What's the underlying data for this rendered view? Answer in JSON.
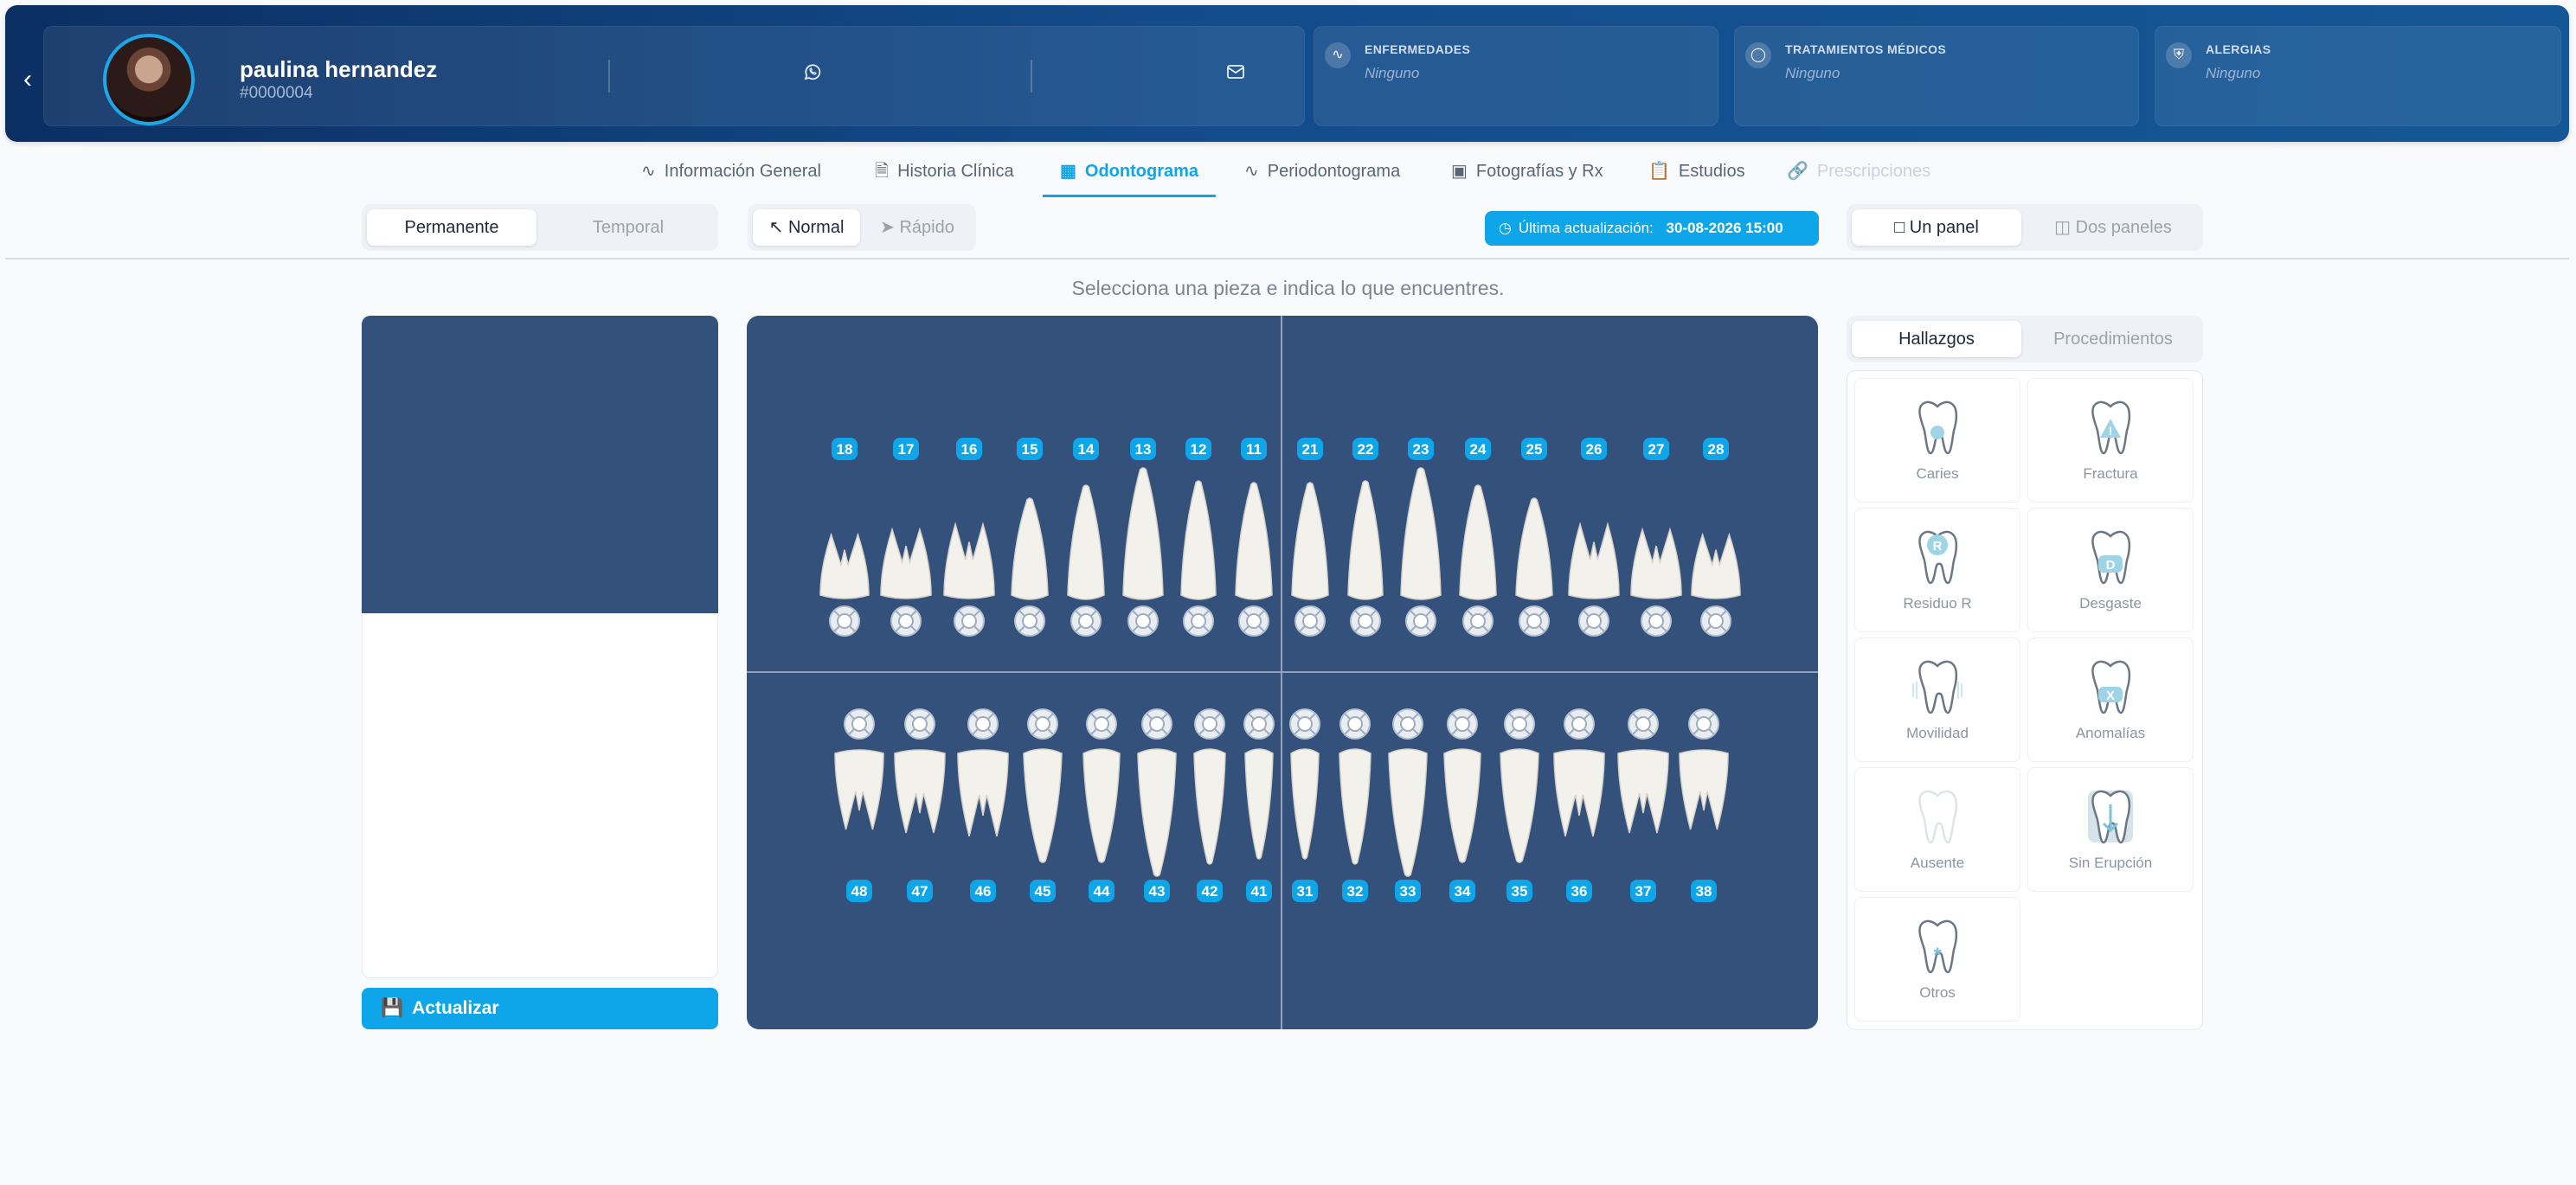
{
  "patient": {
    "name": "paulina hernandez",
    "id": "#0000004"
  },
  "header_icons": [
    "whatsapp-icon",
    "mail-icon"
  ],
  "info_cards": [
    {
      "title": "ENFERMEDADES",
      "value": "Ninguno",
      "icon": "heartbeat-icon"
    },
    {
      "title": "TRATAMIENTOS MÉDICOS",
      "value": "Ninguno",
      "icon": "pill-icon"
    },
    {
      "title": "ALERGIAS",
      "value": "Ninguno",
      "icon": "shield-icon"
    }
  ],
  "tabs": [
    {
      "label": "Información General",
      "icon": "activity-icon",
      "state": "normal"
    },
    {
      "label": "Historia Clínica",
      "icon": "document-icon",
      "state": "normal"
    },
    {
      "label": "Odontograma",
      "icon": "grid-icon",
      "state": "active"
    },
    {
      "label": "Periodontograma",
      "icon": "activity-icon",
      "state": "normal"
    },
    {
      "label": "Fotografías y Rx",
      "icon": "camera-icon",
      "state": "normal"
    },
    {
      "label": "Estudios",
      "icon": "clipboard-icon",
      "state": "normal"
    },
    {
      "label": "Prescripciones",
      "icon": "link-icon",
      "state": "disabled"
    }
  ],
  "toolbar": {
    "dentition": {
      "options": [
        "Permanente",
        "Temporal"
      ],
      "selected": "Permanente"
    },
    "mode": {
      "options": [
        "Normal",
        "Rápido"
      ],
      "selected": "Normal"
    },
    "last_update_label": "Última actualización:",
    "last_update_value": "30-08-2026 15:00",
    "panels": {
      "options": [
        "Un panel",
        "Dos paneles"
      ],
      "selected": "Un panel"
    }
  },
  "hint": "Selecciona una pieza e indica lo que encuentres.",
  "update_button": "Actualizar",
  "odontogram": {
    "upper_teeth": [
      "18",
      "17",
      "16",
      "15",
      "14",
      "13",
      "12",
      "11",
      "21",
      "22",
      "23",
      "24",
      "25",
      "26",
      "27",
      "28"
    ],
    "lower_teeth": [
      "48",
      "47",
      "46",
      "45",
      "44",
      "43",
      "42",
      "41",
      "31",
      "32",
      "33",
      "34",
      "35",
      "36",
      "37",
      "38"
    ]
  },
  "right_panel": {
    "tabs": [
      "Hallazgos",
      "Procedimientos"
    ],
    "selected": "Hallazgos",
    "findings": [
      {
        "label": "Caries",
        "icon": "caries-icon"
      },
      {
        "label": "Fractura",
        "icon": "fracture-icon"
      },
      {
        "label": "Residuo R",
        "icon": "residue-icon",
        "badge": "R"
      },
      {
        "label": "Desgaste",
        "icon": "wear-icon",
        "badge": "D"
      },
      {
        "label": "Movilidad",
        "icon": "mobility-icon"
      },
      {
        "label": "Anomalías",
        "icon": "anomaly-icon",
        "badge": "X"
      },
      {
        "label": "Ausente",
        "icon": "absent-icon"
      },
      {
        "label": "Sin Erupción",
        "icon": "unerupted-icon"
      },
      {
        "label": "Otros",
        "icon": "others-icon",
        "badge": "*"
      }
    ]
  },
  "colors": {
    "accent": "#0ea5e9",
    "header_dark": "#0b2f63",
    "chart_bg": "#34517c",
    "badge": "#0ea5e9"
  }
}
